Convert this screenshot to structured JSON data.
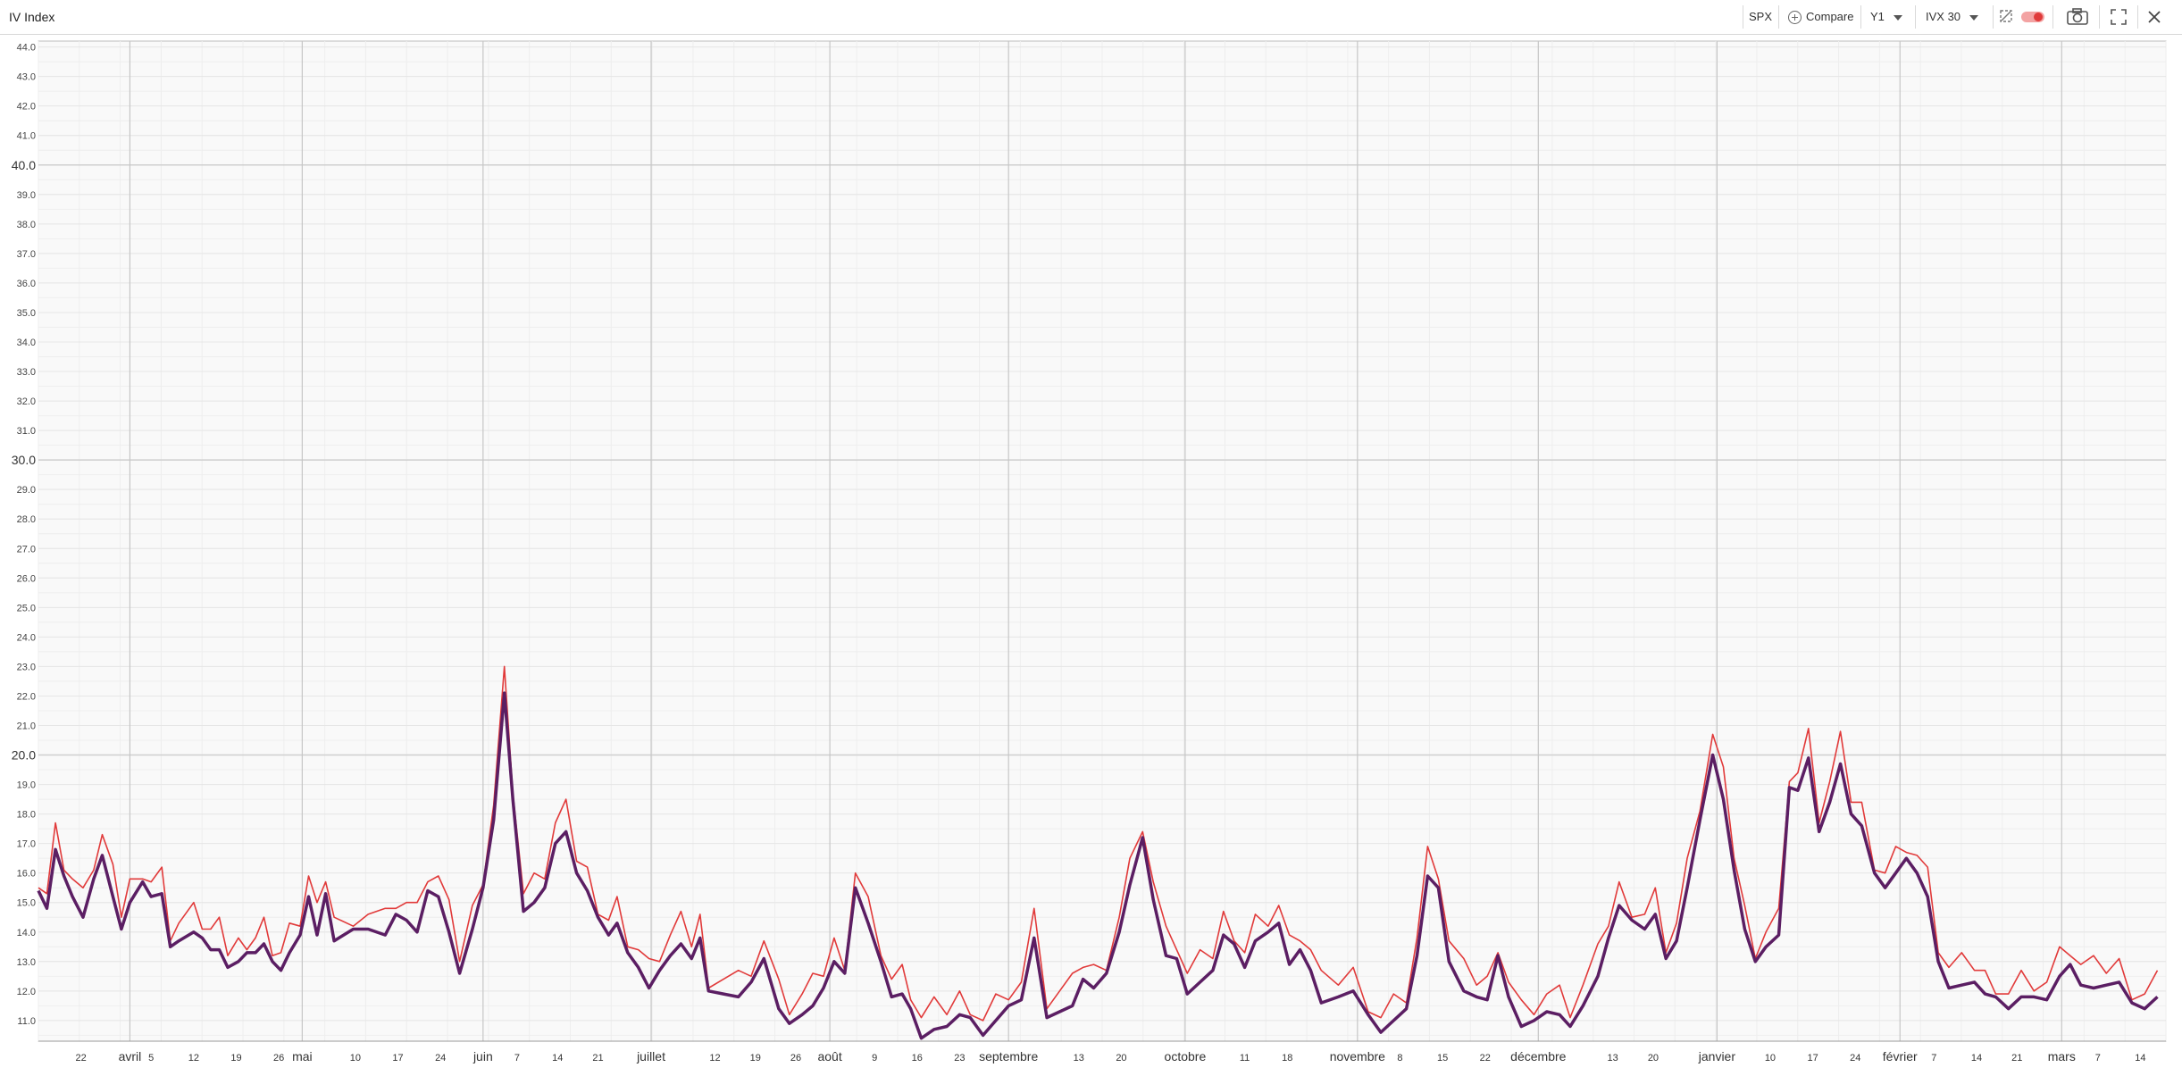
{
  "header": {
    "title": "IV Index",
    "ticker": "SPX",
    "compare_label": "Compare",
    "period": "Y1",
    "metric": "IVX 30"
  },
  "colors": {
    "series1": "#5b1e63",
    "series2": "#e13a3a",
    "grid": "#e6e6e6",
    "major_grid": "#cfcfcf"
  },
  "icons": [
    "plus-circle-icon",
    "chevron-down-icon",
    "dropdown-chevron-icon",
    "reset-icon",
    "toggle-icon",
    "camera-icon",
    "fullscreen-icon",
    "close-icon"
  ],
  "chart_data": {
    "type": "line",
    "ylim": [
      10.3,
      44.2
    ],
    "y_ticks": [
      "11.0",
      "12.0",
      "13.0",
      "14.0",
      "15.0",
      "16.0",
      "17.0",
      "18.0",
      "19.0",
      "20.0",
      "21.0",
      "22.0",
      "23.0",
      "24.0",
      "25.0",
      "26.0",
      "27.0",
      "28.0",
      "29.0",
      "30.0",
      "31.0",
      "32.0",
      "33.0",
      "34.0",
      "35.0",
      "36.0",
      "37.0",
      "38.0",
      "39.0",
      "40.0",
      "41.0",
      "42.0",
      "43.0",
      "44.0"
    ],
    "x_ticks": [
      {
        "label": "22",
        "x": 0.02
      },
      {
        "label": "avril",
        "x": 0.043
      },
      {
        "label": "5",
        "x": 0.053
      },
      {
        "label": "12",
        "x": 0.073
      },
      {
        "label": "19",
        "x": 0.093
      },
      {
        "label": "26",
        "x": 0.113
      },
      {
        "label": "mai",
        "x": 0.124
      },
      {
        "label": "10",
        "x": 0.149
      },
      {
        "label": "17",
        "x": 0.169
      },
      {
        "label": "24",
        "x": 0.189
      },
      {
        "label": "juin",
        "x": 0.209
      },
      {
        "label": "7",
        "x": 0.225
      },
      {
        "label": "14",
        "x": 0.244
      },
      {
        "label": "21",
        "x": 0.263
      },
      {
        "label": "juillet",
        "x": 0.288
      },
      {
        "label": "12",
        "x": 0.318
      },
      {
        "label": "19",
        "x": 0.337
      },
      {
        "label": "26",
        "x": 0.356
      },
      {
        "label": "août",
        "x": 0.372
      },
      {
        "label": "9",
        "x": 0.393
      },
      {
        "label": "16",
        "x": 0.413
      },
      {
        "label": "23",
        "x": 0.433
      },
      {
        "label": "septembre",
        "x": 0.456
      },
      {
        "label": "13",
        "x": 0.489
      },
      {
        "label": "20",
        "x": 0.509
      },
      {
        "label": "octobre",
        "x": 0.539
      },
      {
        "label": "11",
        "x": 0.567
      },
      {
        "label": "18",
        "x": 0.587
      },
      {
        "label": "novembre",
        "x": 0.62
      },
      {
        "label": "8",
        "x": 0.64
      },
      {
        "label": "15",
        "x": 0.66
      },
      {
        "label": "22",
        "x": 0.68
      },
      {
        "label": "décembre",
        "x": 0.705
      },
      {
        "label": "13",
        "x": 0.74
      },
      {
        "label": "20",
        "x": 0.759
      },
      {
        "label": "janvier",
        "x": 0.789
      },
      {
        "label": "10",
        "x": 0.814
      },
      {
        "label": "17",
        "x": 0.834
      },
      {
        "label": "24",
        "x": 0.854
      },
      {
        "label": "février",
        "x": 0.875
      },
      {
        "label": "7",
        "x": 0.891
      },
      {
        "label": "14",
        "x": 0.911
      },
      {
        "label": "21",
        "x": 0.93
      },
      {
        "label": "mars",
        "x": 0.951
      },
      {
        "label": "7",
        "x": 0.968
      },
      {
        "label": "14",
        "x": 0.988
      }
    ],
    "month_lines": [
      0.043,
      0.124,
      0.209,
      0.288,
      0.372,
      0.456,
      0.539,
      0.62,
      0.705,
      0.789,
      0.875,
      0.951
    ],
    "major_y": [
      20,
      30,
      40
    ],
    "grid": true,
    "series": [
      {
        "points": [
          [
            0.0,
            15.4
          ],
          [
            0.004,
            14.8
          ],
          [
            0.008,
            16.8
          ],
          [
            0.012,
            15.9
          ],
          [
            0.016,
            15.2
          ],
          [
            0.021,
            14.5
          ],
          [
            0.026,
            15.8
          ],
          [
            0.03,
            16.6
          ],
          [
            0.035,
            15.2
          ],
          [
            0.039,
            14.1
          ],
          [
            0.043,
            15.0
          ],
          [
            0.049,
            15.7
          ],
          [
            0.053,
            15.2
          ],
          [
            0.058,
            15.3
          ],
          [
            0.062,
            13.5
          ],
          [
            0.066,
            13.7
          ],
          [
            0.073,
            14.0
          ],
          [
            0.077,
            13.8
          ],
          [
            0.081,
            13.4
          ],
          [
            0.085,
            13.4
          ],
          [
            0.089,
            12.8
          ],
          [
            0.094,
            13.0
          ],
          [
            0.098,
            13.3
          ],
          [
            0.102,
            13.3
          ],
          [
            0.106,
            13.6
          ],
          [
            0.11,
            13.0
          ],
          [
            0.114,
            12.7
          ],
          [
            0.118,
            13.3
          ],
          [
            0.123,
            13.9
          ],
          [
            0.127,
            15.2
          ],
          [
            0.131,
            13.9
          ],
          [
            0.135,
            15.3
          ],
          [
            0.139,
            13.7
          ],
          [
            0.148,
            14.1
          ],
          [
            0.155,
            14.1
          ],
          [
            0.163,
            13.9
          ],
          [
            0.168,
            14.6
          ],
          [
            0.173,
            14.4
          ],
          [
            0.178,
            14.0
          ],
          [
            0.183,
            15.4
          ],
          [
            0.188,
            15.2
          ],
          [
            0.193,
            14.0
          ],
          [
            0.198,
            12.6
          ],
          [
            0.204,
            14.1
          ],
          [
            0.209,
            15.5
          ],
          [
            0.214,
            17.8
          ],
          [
            0.219,
            22.1
          ],
          [
            0.223,
            18.5
          ],
          [
            0.228,
            14.7
          ],
          [
            0.233,
            15.0
          ],
          [
            0.238,
            15.5
          ],
          [
            0.243,
            17.0
          ],
          [
            0.248,
            17.4
          ],
          [
            0.253,
            16.0
          ],
          [
            0.258,
            15.4
          ],
          [
            0.263,
            14.5
          ],
          [
            0.268,
            13.9
          ],
          [
            0.272,
            14.3
          ],
          [
            0.277,
            13.3
          ],
          [
            0.282,
            12.8
          ],
          [
            0.287,
            12.1
          ],
          [
            0.292,
            12.7
          ],
          [
            0.297,
            13.2
          ],
          [
            0.302,
            13.6
          ],
          [
            0.307,
            13.1
          ],
          [
            0.311,
            13.8
          ],
          [
            0.315,
            12.0
          ],
          [
            0.322,
            11.9
          ],
          [
            0.329,
            11.8
          ],
          [
            0.335,
            12.3
          ],
          [
            0.341,
            13.1
          ],
          [
            0.348,
            11.4
          ],
          [
            0.353,
            10.9
          ],
          [
            0.359,
            11.2
          ],
          [
            0.364,
            11.5
          ],
          [
            0.369,
            12.1
          ],
          [
            0.374,
            13.0
          ],
          [
            0.379,
            12.6
          ],
          [
            0.384,
            15.5
          ],
          [
            0.39,
            14.3
          ],
          [
            0.396,
            13.0
          ],
          [
            0.401,
            11.8
          ],
          [
            0.406,
            11.9
          ],
          [
            0.41,
            11.4
          ],
          [
            0.415,
            10.4
          ],
          [
            0.421,
            10.7
          ],
          [
            0.427,
            10.8
          ],
          [
            0.433,
            11.2
          ],
          [
            0.438,
            11.1
          ],
          [
            0.444,
            10.5
          ],
          [
            0.45,
            11.0
          ],
          [
            0.456,
            11.5
          ],
          [
            0.462,
            11.7
          ],
          [
            0.468,
            13.8
          ],
          [
            0.474,
            11.1
          ],
          [
            0.48,
            11.3
          ],
          [
            0.486,
            11.5
          ],
          [
            0.491,
            12.4
          ],
          [
            0.496,
            12.1
          ],
          [
            0.502,
            12.6
          ],
          [
            0.508,
            14.0
          ],
          [
            0.513,
            15.6
          ],
          [
            0.519,
            17.2
          ],
          [
            0.524,
            15.1
          ],
          [
            0.53,
            13.2
          ],
          [
            0.535,
            13.1
          ],
          [
            0.54,
            11.9
          ],
          [
            0.546,
            12.3
          ],
          [
            0.552,
            12.7
          ],
          [
            0.557,
            13.9
          ],
          [
            0.562,
            13.6
          ],
          [
            0.567,
            12.8
          ],
          [
            0.572,
            13.7
          ],
          [
            0.578,
            14.0
          ],
          [
            0.583,
            14.3
          ],
          [
            0.588,
            12.9
          ],
          [
            0.593,
            13.4
          ],
          [
            0.598,
            12.7
          ],
          [
            0.603,
            11.6
          ],
          [
            0.611,
            11.8
          ],
          [
            0.618,
            12.0
          ],
          [
            0.625,
            11.2
          ],
          [
            0.631,
            10.6
          ],
          [
            0.637,
            11.0
          ],
          [
            0.643,
            11.4
          ],
          [
            0.648,
            13.2
          ],
          [
            0.653,
            15.9
          ],
          [
            0.658,
            15.5
          ],
          [
            0.663,
            13.0
          ],
          [
            0.67,
            12.0
          ],
          [
            0.676,
            11.8
          ],
          [
            0.681,
            11.7
          ],
          [
            0.686,
            13.2
          ],
          [
            0.691,
            11.8
          ],
          [
            0.697,
            10.8
          ],
          [
            0.703,
            11.0
          ],
          [
            0.709,
            11.3
          ],
          [
            0.715,
            11.2
          ],
          [
            0.72,
            10.8
          ],
          [
            0.726,
            11.5
          ],
          [
            0.733,
            12.5
          ],
          [
            0.738,
            13.8
          ],
          [
            0.743,
            14.9
          ],
          [
            0.749,
            14.4
          ],
          [
            0.755,
            14.1
          ],
          [
            0.76,
            14.6
          ],
          [
            0.765,
            13.1
          ],
          [
            0.77,
            13.7
          ],
          [
            0.775,
            15.5
          ],
          [
            0.781,
            17.8
          ],
          [
            0.787,
            20.0
          ],
          [
            0.792,
            18.5
          ],
          [
            0.797,
            16.1
          ],
          [
            0.802,
            14.1
          ],
          [
            0.807,
            13.0
          ],
          [
            0.812,
            13.5
          ],
          [
            0.818,
            13.9
          ],
          [
            0.823,
            18.9
          ],
          [
            0.827,
            18.8
          ],
          [
            0.832,
            19.9
          ],
          [
            0.837,
            17.4
          ],
          [
            0.842,
            18.4
          ],
          [
            0.847,
            19.7
          ],
          [
            0.852,
            18.0
          ],
          [
            0.857,
            17.6
          ],
          [
            0.863,
            16.0
          ],
          [
            0.868,
            15.5
          ],
          [
            0.873,
            16.0
          ],
          [
            0.878,
            16.5
          ],
          [
            0.883,
            16.0
          ],
          [
            0.888,
            15.2
          ],
          [
            0.893,
            13.0
          ],
          [
            0.898,
            12.1
          ],
          [
            0.904,
            12.2
          ],
          [
            0.91,
            12.3
          ],
          [
            0.915,
            11.9
          ],
          [
            0.92,
            11.8
          ],
          [
            0.926,
            11.4
          ],
          [
            0.932,
            11.8
          ],
          [
            0.938,
            11.8
          ],
          [
            0.944,
            11.7
          ],
          [
            0.95,
            12.5
          ],
          [
            0.955,
            12.9
          ],
          [
            0.96,
            12.2
          ],
          [
            0.966,
            12.1
          ],
          [
            0.972,
            12.2
          ],
          [
            0.978,
            12.3
          ],
          [
            0.984,
            11.6
          ],
          [
            0.99,
            11.4
          ],
          [
            0.996,
            11.8
          ]
        ]
      }
    ]
  }
}
